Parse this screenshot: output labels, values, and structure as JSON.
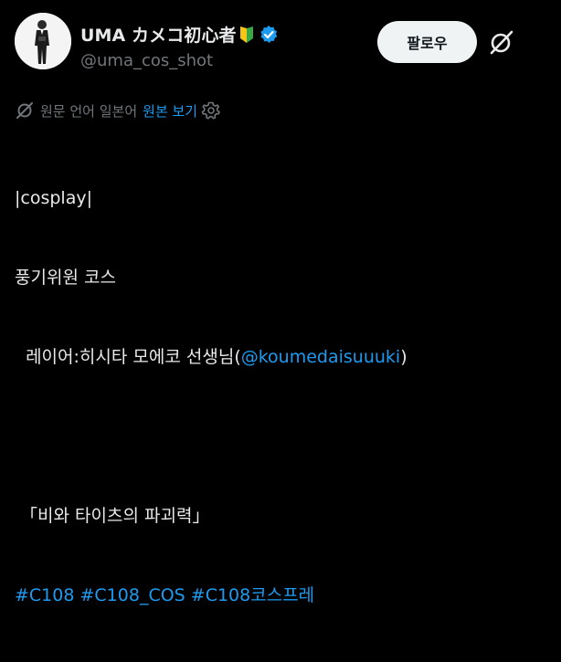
{
  "author": {
    "display_name": "UMA カメコ初心者",
    "badge_icon": "beginner-mark-icon",
    "verified_icon": "verified-badge-icon",
    "handle": "@uma_cos_shot"
  },
  "actions": {
    "follow_label": "팔로우",
    "grok_icon": "grok-icon"
  },
  "translation": {
    "note": "원문 언어 일본어",
    "show_original": "원본 보기",
    "settings_icon": "gear-icon"
  },
  "post": {
    "line1": "|cosplay|",
    "line2": "풍기위원 코스",
    "line3_prefix": "  레이어:히시타 모에코 선생님(",
    "line3_mention": "@koumedaisuuuki",
    "line3_suffix": ")",
    "line5": " 「비와 타이츠의 파괴력」",
    "hashtags": [
      "#C108",
      "#C108_COS",
      "#C108코스프레"
    ]
  },
  "colors": {
    "background": "#000000",
    "text": "#e7e9ea",
    "muted": "#71767b",
    "link": "#1d9bf0",
    "verified": "#1d9bf0",
    "follow_bg": "#eff3f4"
  }
}
